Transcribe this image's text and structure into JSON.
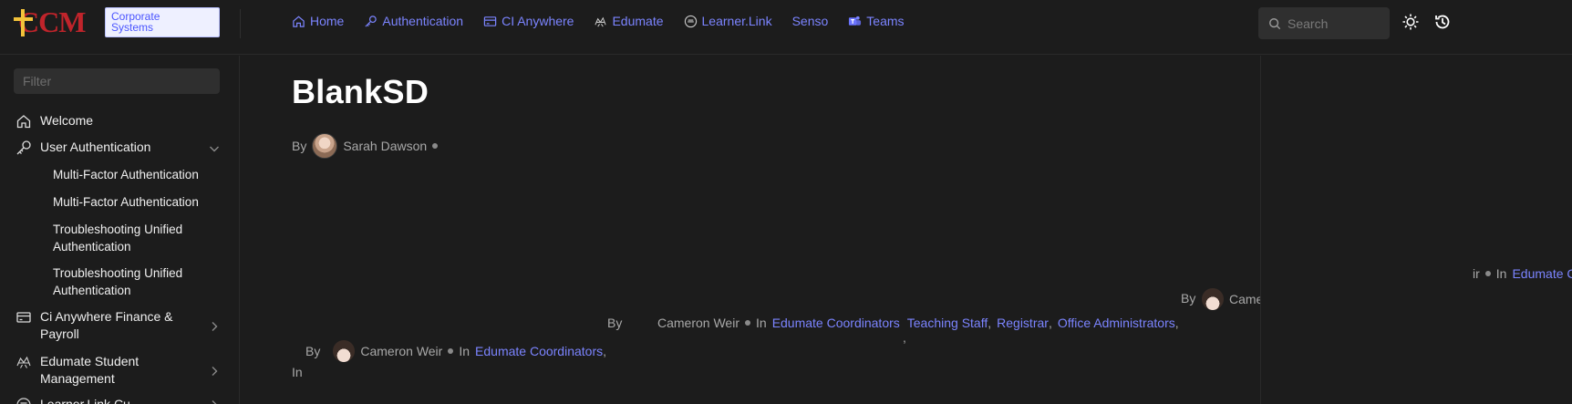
{
  "brand": {
    "logo_text": "CCM",
    "badge_line1": "Corporate",
    "badge_line2": "Systems"
  },
  "nav": {
    "items": [
      {
        "label": "Home",
        "icon": "home-icon"
      },
      {
        "label": "Authentication",
        "icon": "key-icon"
      },
      {
        "label": "CI Anywhere",
        "icon": "card-icon"
      },
      {
        "label": "Edumate",
        "icon": "edumate-icon"
      },
      {
        "label": "Learner.Link",
        "icon": "learnerlink-icon"
      },
      {
        "label": "Senso",
        "icon": ""
      },
      {
        "label": "Teams",
        "icon": "teams-icon"
      }
    ]
  },
  "search": {
    "placeholder": "Search"
  },
  "sidebar": {
    "filter_placeholder": "Filter",
    "items": [
      {
        "label": "Welcome",
        "icon": "home-icon"
      },
      {
        "label": "User Authentication",
        "icon": "key-icon"
      },
      {
        "label": "Multi-Factor Authentication"
      },
      {
        "label": "Multi-Factor Authentication"
      },
      {
        "label": "Troubleshooting Unified Authentication"
      },
      {
        "label": "Troubleshooting Unified Authentication"
      },
      {
        "label": "Ci Anywhere Finance & Payroll",
        "icon": "card-icon"
      },
      {
        "label": "Edumate Student Management",
        "icon": "edumate-icon"
      },
      {
        "label": "Learner.Link Cu",
        "icon": "learnerlink-icon"
      }
    ]
  },
  "page": {
    "title": "BlankSD",
    "by": "By",
    "author": "Sarah Dawson"
  },
  "fragments": {
    "by": "By",
    "in": "In",
    "author": "Cameron Weir",
    "author_cut": "Came",
    "tail_ir": "ir",
    "edumate_cut": "Edumate C",
    "comma": ",",
    "categories": [
      "Edumate Coordinators",
      "Teaching Staff",
      "Registrar",
      "Office Administrators"
    ]
  },
  "colors": {
    "background": "#1c1c1c",
    "accent": "#7b84ff",
    "text": "#e6e6e6",
    "muted": "#a8a8a8"
  }
}
